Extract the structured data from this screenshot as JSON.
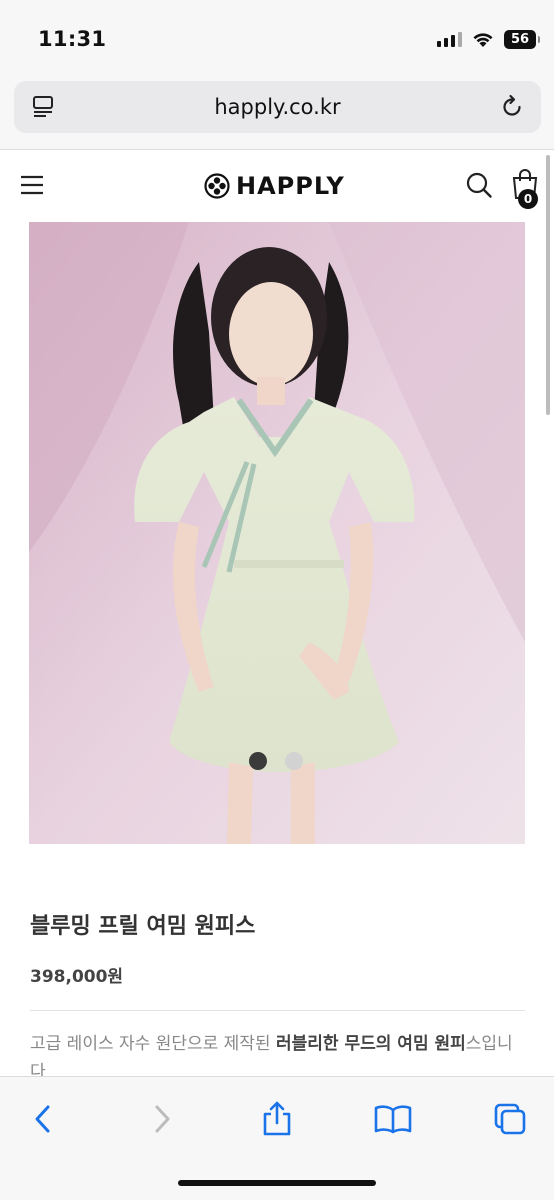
{
  "status_bar": {
    "time": "11:31",
    "battery": "56"
  },
  "browser": {
    "url": "happly.co.kr"
  },
  "site": {
    "brand": "HAPPLY",
    "cart_count": "0"
  },
  "product": {
    "title": "블루밍 프릴 여밈 원피스",
    "price": "398,000원",
    "description_plain": "고급 레이스 자수 원단으로 제작된 ",
    "description_bold": "러블리한 무드의 여밈 원피",
    "description_tail": "스입니다"
  },
  "carousel": {
    "active_index": 0,
    "count": 2
  },
  "colors": {
    "accent": "#1a73e8",
    "inactive": "#bcbcbc",
    "text": "#222222"
  },
  "icons": {
    "reader": "reader-icon",
    "reload": "reload-icon",
    "menu": "hamburger-icon",
    "search": "search-icon",
    "cart": "shopping-bag-icon",
    "back": "chevron-left-icon",
    "forward": "chevron-right-icon",
    "share": "share-icon",
    "bookmarks": "book-icon",
    "tabs": "tabs-icon"
  }
}
